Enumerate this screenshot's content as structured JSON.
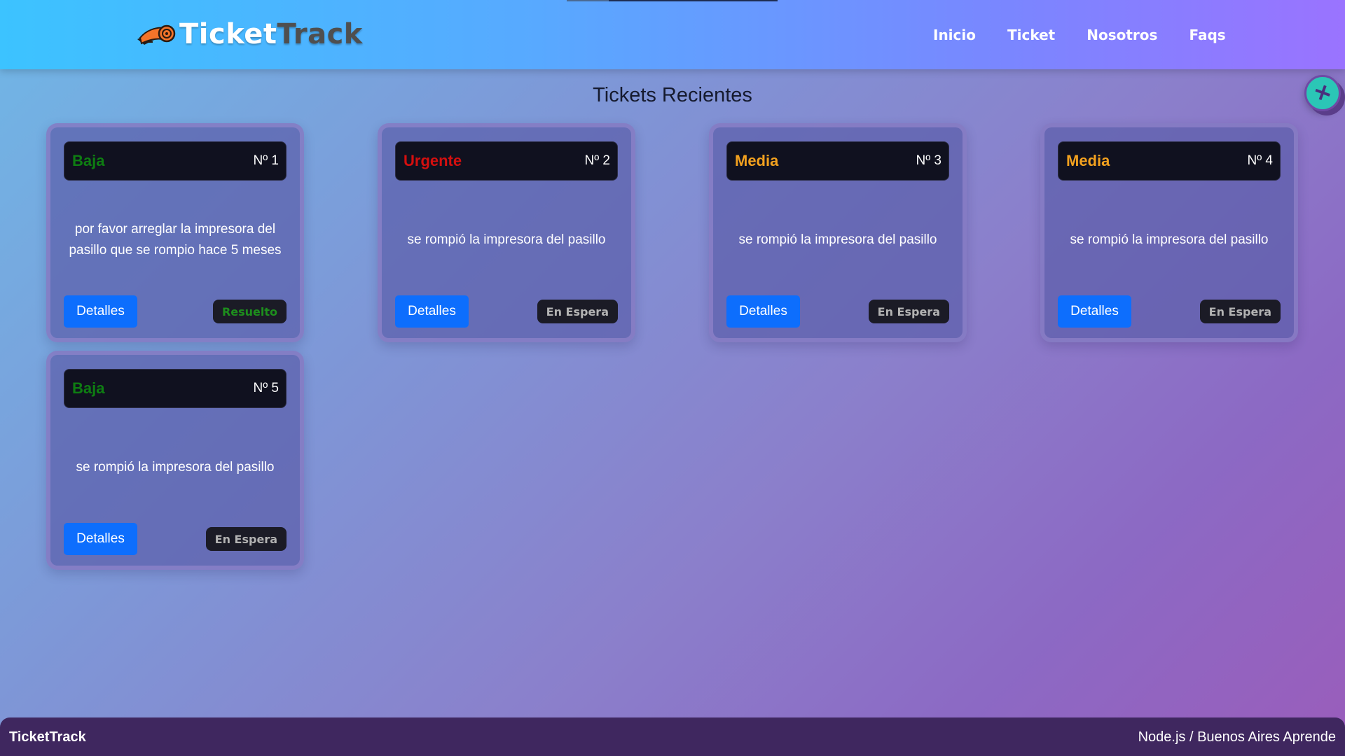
{
  "header": {
    "brand_part1": "Ticket",
    "brand_part2": "Track",
    "nav": [
      "Inicio",
      "Ticket",
      "Nosotros",
      "Faqs"
    ]
  },
  "main": {
    "title": "Tickets Recientes",
    "add_button_icon": "+"
  },
  "tickets": [
    {
      "priority": "Baja",
      "number": "Nº 1",
      "description": "por favor arreglar la impresora del pasillo que se rompio hace 5 meses",
      "details_label": "Detalles",
      "status": "Resuelto"
    },
    {
      "priority": "Urgente",
      "number": "Nº 2",
      "description": "se rompió la impresora del pasillo",
      "details_label": "Detalles",
      "status": "En Espera"
    },
    {
      "priority": "Media",
      "number": "Nº 3",
      "description": "se rompió la impresora del pasillo",
      "details_label": "Detalles",
      "status": "En Espera"
    },
    {
      "priority": "Media",
      "number": "Nº 4",
      "description": "se rompió la impresora del pasillo",
      "details_label": "Detalles",
      "status": "En Espera"
    },
    {
      "priority": "Baja",
      "number": "Nº 5",
      "description": "se rompió la impresora del pasillo",
      "details_label": "Detalles",
      "status": "En Espera"
    }
  ],
  "footer": {
    "brand": "TicketTrack",
    "credit": "Node.js / Buenos Aires Aprende"
  },
  "colors": {
    "priority_low": "#0e7d12",
    "priority_urgent": "#d40f0f",
    "priority_medium": "#f2a11f",
    "button_primary": "#0d6efd",
    "status_resolved": "#1d8e1d",
    "status_waiting": "#b3b3b3",
    "footer_bg": "#3f275f",
    "fab_bg": "#2bc6b6"
  },
  "icons": {
    "logo": "orange-scroll-logo-icon",
    "add": "plus-icon"
  }
}
